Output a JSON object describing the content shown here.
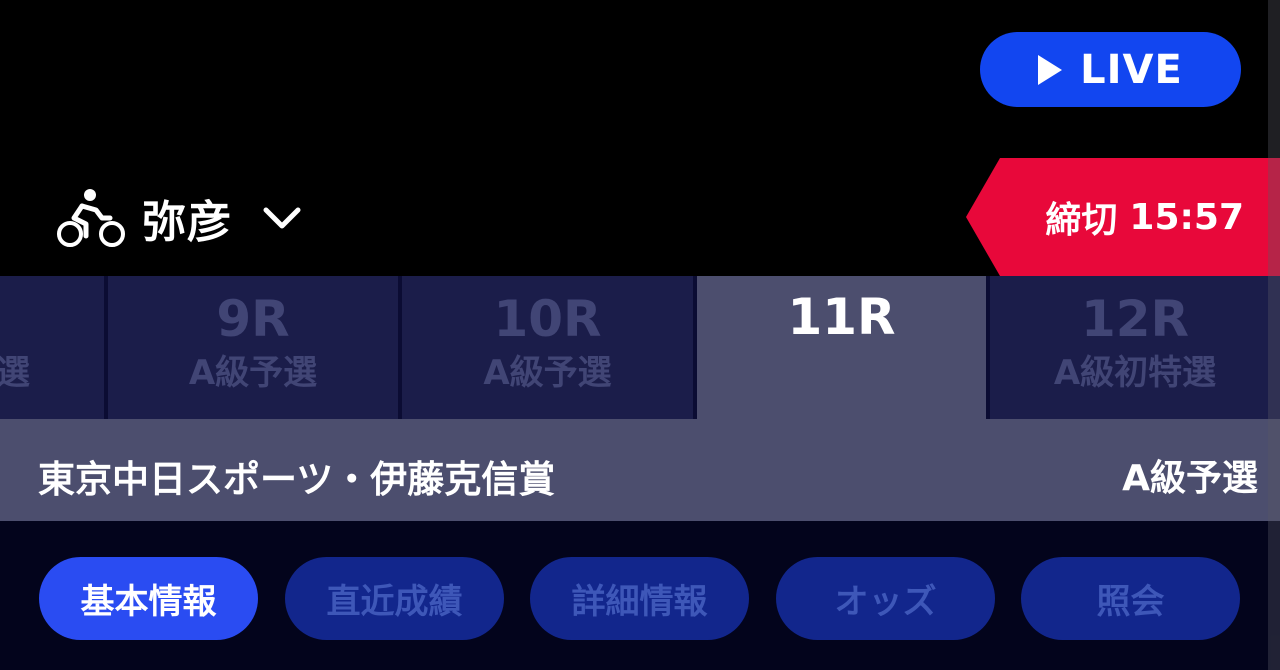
{
  "header": {
    "live_label": "LIVE",
    "venue_name": "弥彦",
    "deadline_label": "締切",
    "deadline_time": "15:57"
  },
  "race_tabs": [
    {
      "number": "",
      "class": "選",
      "active": false
    },
    {
      "number": "9R",
      "class": "A級予選",
      "active": false
    },
    {
      "number": "10R",
      "class": "A級予選",
      "active": false
    },
    {
      "number": "11R",
      "class": "",
      "active": true
    },
    {
      "number": "12R",
      "class": "A級初特選",
      "active": false
    }
  ],
  "race_info": {
    "title": "東京中日スポーツ・伊藤克信賞",
    "grade": "A級予選"
  },
  "sub_tabs": [
    {
      "label": "基本情報",
      "active": true
    },
    {
      "label": "直近成績",
      "active": false
    },
    {
      "label": "詳細情報",
      "active": false
    },
    {
      "label": "オッズ",
      "active": false
    },
    {
      "label": "照会",
      "active": false
    }
  ],
  "colors": {
    "live_blue": "#1246f0",
    "deadline_red": "#e8083a",
    "tab_active_bg": "#4c4e6e",
    "subtab_active_bg": "#2a4cf2"
  }
}
